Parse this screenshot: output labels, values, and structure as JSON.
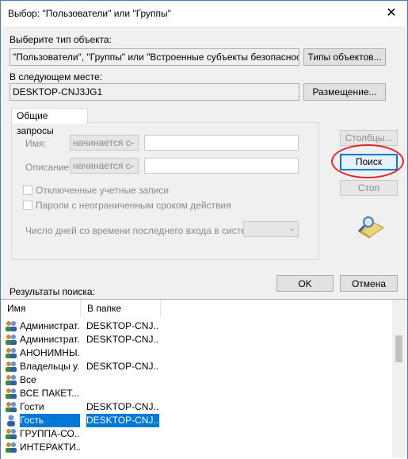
{
  "window": {
    "title": "Выбор: \"Пользователи\" или \"Группы\"",
    "close_glyph": "✕"
  },
  "object_type": {
    "label": "Выберите тип объекта:",
    "value": "\"Пользователи\", \"Группы\" или \"Встроенные субъекты безопасности\"",
    "button": "Типы объектов..."
  },
  "location": {
    "label": "В следующем месте:",
    "value": "DESKTOP-CNJ3JG1",
    "button": "Размещение..."
  },
  "queries": {
    "tab": "Общие запросы",
    "name_label": "Имя:",
    "name_mode": "начинается с",
    "desc_label": "Описание:",
    "desc_mode": "начинается с",
    "disabled_accounts": "Отключенные учетные записи",
    "no_expire_pwd": "Пароли с неограниченным сроком действия",
    "days_label": "Число дней со времени последнего входа в систему:"
  },
  "buttons": {
    "columns": "Столбцы...",
    "search": "Поиск",
    "stop": "Стоп",
    "ok": "OK",
    "cancel": "Отмена"
  },
  "results": {
    "label": "Результаты поиска:",
    "col_name": "Имя",
    "col_folder": "В папке",
    "rows": [
      {
        "name": "Администрат...",
        "folder": "DESKTOP-CNJ..."
      },
      {
        "name": "Администрат...",
        "folder": "DESKTOP-CNJ..."
      },
      {
        "name": "АНОНИМНЫ...",
        "folder": ""
      },
      {
        "name": "Владельцы у...",
        "folder": "DESKTOP-CNJ..."
      },
      {
        "name": "Все",
        "folder": ""
      },
      {
        "name": "ВСЕ ПАКЕТ...",
        "folder": ""
      },
      {
        "name": "Гости",
        "folder": "DESKTOP-CNJ..."
      },
      {
        "name": "Гость",
        "folder": "DESKTOP-CNJ..."
      },
      {
        "name": "ГРУППА-СО...",
        "folder": ""
      },
      {
        "name": "ИНТЕРАКТИ...",
        "folder": ""
      }
    ]
  },
  "colors": {
    "accent": "#0078d7",
    "highlight_circle": "#e4262a"
  }
}
